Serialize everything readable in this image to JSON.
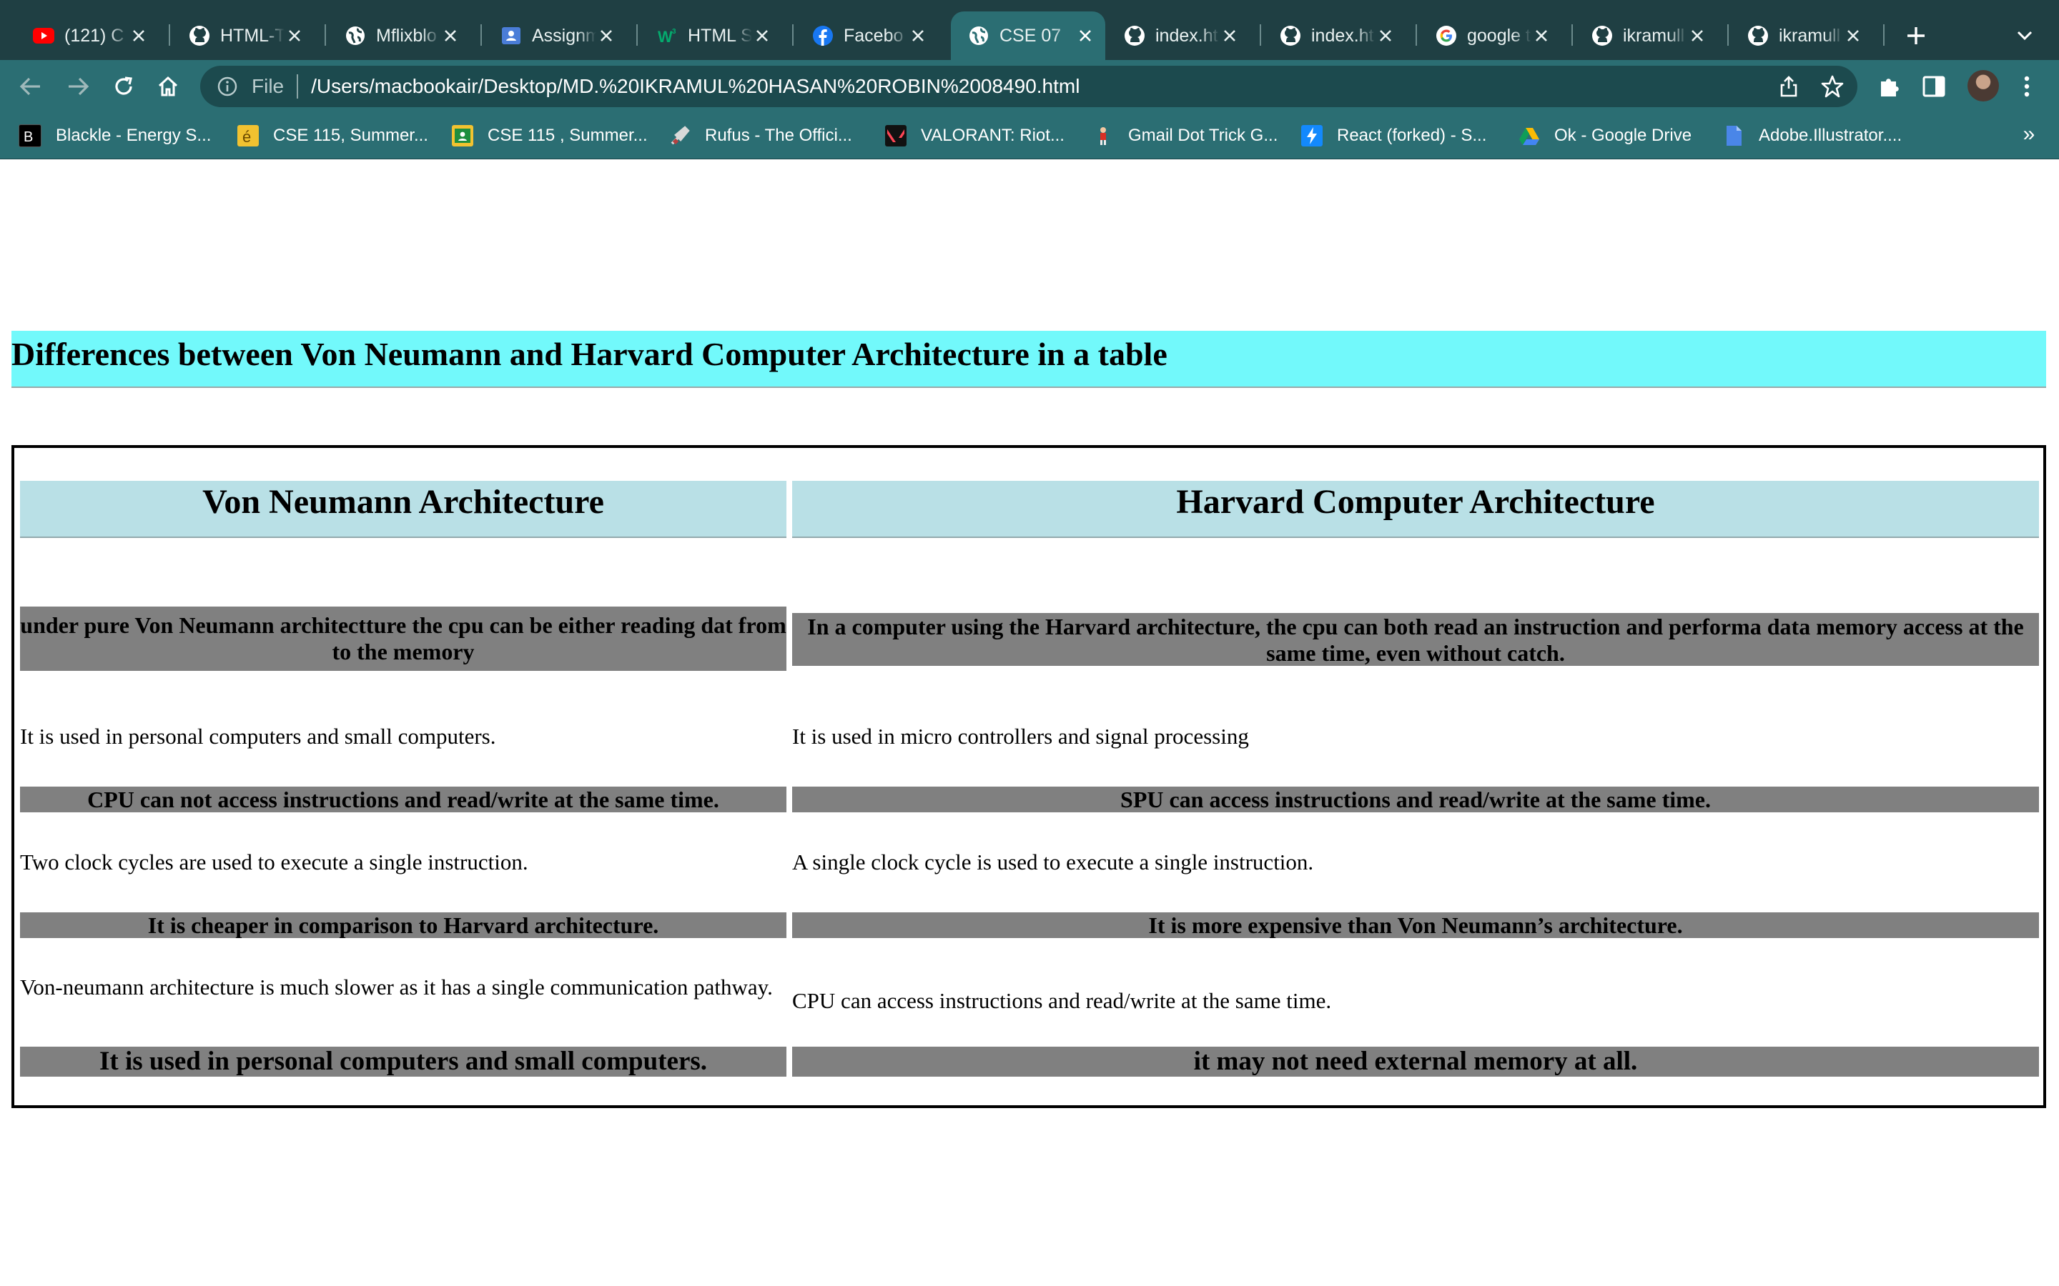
{
  "browser": {
    "tabs": [
      {
        "title": "(121) C",
        "favicon": "youtube-icon",
        "active": false
      },
      {
        "title": "HTML-T",
        "favicon": "github-icon",
        "active": false
      },
      {
        "title": "Mflixblo",
        "favicon": "globe-icon",
        "active": false
      },
      {
        "title": "Assignm",
        "favicon": "classroom-icon",
        "active": false
      },
      {
        "title": "HTML S",
        "favicon": "w3schools-icon",
        "active": false
      },
      {
        "title": "Facebo",
        "favicon": "facebook-icon",
        "active": false
      },
      {
        "title": "CSE 07",
        "favicon": "globe-icon",
        "active": true
      },
      {
        "title": "index.ht",
        "favicon": "github-icon",
        "active": false
      },
      {
        "title": "index.ht",
        "favicon": "github-icon",
        "active": false
      },
      {
        "title": "google t",
        "favicon": "google-icon",
        "active": false
      },
      {
        "title": "ikramull",
        "favicon": "github-icon",
        "active": false
      },
      {
        "title": "ikramull",
        "favicon": "github-icon",
        "active": false
      }
    ],
    "address_bar": {
      "scheme_label": "File",
      "url": "/Users/macbookair/Desktop/MD.%20IKRAMUL%20HASAN%20ROBIN%2008490.html"
    },
    "bookmarks": [
      {
        "label": "Blackle - Energy S...",
        "icon": "blackle-icon",
        "color": "#000000"
      },
      {
        "label": "CSE 115, Summer...",
        "icon": "eduhub-icon",
        "color": "#f2c230"
      },
      {
        "label": "CSE 115 , Summer...",
        "icon": "classroom-icon",
        "color": "#f2c230"
      },
      {
        "label": "Rufus - The Offici...",
        "icon": "rufus-icon",
        "color": "#cfcfcf"
      },
      {
        "label": "VALORANT: Riot...",
        "icon": "valorant-icon",
        "color": "#e63946"
      },
      {
        "label": "Gmail Dot Trick G...",
        "icon": "gmail-dot-trick-icon",
        "color": "#d93025"
      },
      {
        "label": "React (forked) - S...",
        "icon": "stackblitz-icon",
        "color": "#1389fd"
      },
      {
        "label": "Ok - Google Drive",
        "icon": "google-drive-icon",
        "color": "#fbbc04"
      },
      {
        "label": "Adobe.Illustrator....",
        "icon": "document-icon",
        "color": "#4a86e8"
      }
    ],
    "bookmarks_overflow": "»"
  },
  "page": {
    "heading": "Differences between Von Neumann and Harvard Computer Architecture in a table",
    "table": {
      "headers": [
        "Von Neumann Architecture",
        "Harvard Computer Architecture"
      ],
      "rows": [
        {
          "style": "highlight",
          "von_neumann": "under pure Von Neumann architectture the cpu can be either reading dat from to the memory",
          "harvard": "In a computer using the Harvard architecture, the cpu can both read an instruction and performa data memory access at the same time, even without catch."
        },
        {
          "style": "plain",
          "von_neumann": "It is used in personal computers and small computers.",
          "harvard": "It is used in micro controllers and signal processing"
        },
        {
          "style": "highlight",
          "von_neumann": "CPU can not access instructions and read/write at the same time.",
          "harvard": "SPU can access instructions and read/write at the same time."
        },
        {
          "style": "plain",
          "von_neumann": "Two clock cycles are used to execute a single instruction.",
          "harvard": "A single clock cycle is used to execute a single instruction."
        },
        {
          "style": "highlight",
          "von_neumann": "It is cheaper in comparison to Harvard architecture.",
          "harvard": "It is more expensive than Von Neumann’s architecture."
        },
        {
          "style": "plain",
          "von_neumann": "Von-neumann architecture is much slower as it has a single communication pathway.",
          "harvard": "CPU can access instructions and read/write at the same time."
        },
        {
          "style": "highlight-large",
          "von_neumann": "It is used in personal computers and small computers.",
          "harvard": "it may not need external memory at all."
        }
      ]
    },
    "colors": {
      "heading_bg": "#72f9fb",
      "header_bg": "#b9e0e6",
      "highlight_row_bg": "#808080",
      "browser_tab_bar": "#1f3f43",
      "browser_toolbar": "#2b6e73"
    }
  }
}
